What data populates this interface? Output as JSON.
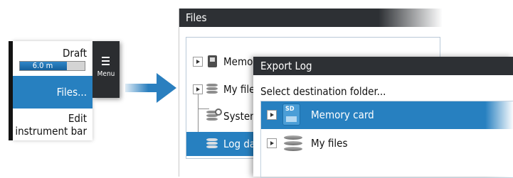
{
  "menu": {
    "button_label": "Menu",
    "icon": "hamburger-icon",
    "draft": {
      "label": "Draft",
      "value": "6.0 m",
      "fill_fraction": 0.72,
      "accent": "#1f75b8"
    },
    "items": [
      {
        "label": "Files...",
        "selected": true
      },
      {
        "label": "Edit instrument bar",
        "selected": false
      }
    ]
  },
  "arrow": {
    "color": "#2a7fbf"
  },
  "files_window": {
    "title": "Files",
    "rows": [
      {
        "label": "Memory card",
        "icon": "memory-card-icon",
        "expander": true,
        "selected": false
      },
      {
        "label": "My files",
        "icon": "database-icon",
        "expander": true,
        "selected": false
      },
      {
        "label": "System",
        "icon": "system-database-icon",
        "expander": false,
        "selected": false
      },
      {
        "label": "Log dat",
        "icon": "database-icon",
        "expander": false,
        "selected": true
      }
    ]
  },
  "export_dialog": {
    "title": "Export Log",
    "prompt": "Select destination folder...",
    "accent": "#2780c0",
    "rows": [
      {
        "label": "Memory card",
        "icon": "sd-card-icon",
        "selected": true
      },
      {
        "label": "My files",
        "icon": "database-icon",
        "selected": false
      }
    ]
  }
}
